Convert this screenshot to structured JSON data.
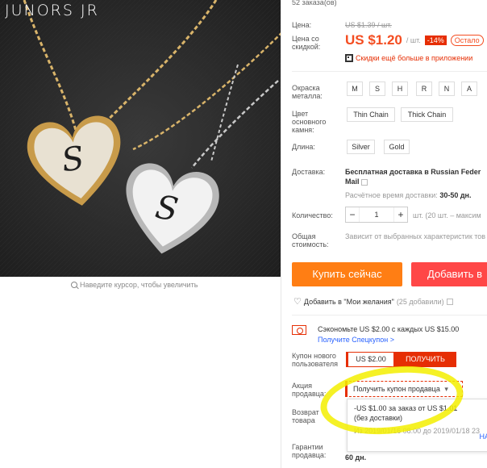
{
  "brand": "JUNORS JR",
  "zoom_hint": "Наведите курсор, чтобы увеличить",
  "orders": "52 заказа(ов)",
  "price": {
    "label": "Цена:",
    "old": "US $1.39 / шт.",
    "discount_label": "Цена со скидкой:",
    "current": "US $1.20",
    "unit": "/ шт.",
    "discount": "-14%",
    "remaining": "Остало",
    "app_promo": "Скидки ещё больше в приложении"
  },
  "options": {
    "metal_label": "Окраска металла:",
    "metal_values": [
      "M",
      "S",
      "H",
      "R",
      "N",
      "A"
    ],
    "stone_label": "Цвет основного камня:",
    "stone_values": [
      "Thin Chain",
      "Thick Chain"
    ],
    "length_label": "Длина:",
    "length_values": [
      "Silver",
      "Gold"
    ]
  },
  "shipping": {
    "label": "Доставка:",
    "line1_bold": "Бесплатная доставка",
    "line1_rest": " в Russian Feder",
    "line2": "Mail",
    "time_label": "Расчётное время доставки:",
    "time_value": "30-50 дн."
  },
  "quantity": {
    "label": "Количество:",
    "minus": "−",
    "value": "1",
    "plus": "+",
    "stock": "шт. (20 шт. – максим"
  },
  "total": {
    "label": "Общая стоимость:",
    "value": "Зависит от выбранных характеристик тов"
  },
  "buttons": {
    "buy": "Купить сейчас",
    "cart": "Добавить в"
  },
  "wishlist": {
    "text": "Добавить в \"Мои желания\"",
    "count": "(25 добавили)"
  },
  "coupon": {
    "save_text": "Сэкономьте US $2.00 с каждых US $15.00",
    "special_link": "Получите Спецкупон >",
    "new_user_label": "Купон нового пользователя",
    "amount": "US $2.00",
    "get_button": "ПОЛУЧИТЬ",
    "seller_label": "Акция продавца:",
    "seller_select": "Получить купон продавца",
    "offer_line1": "-US $1.00 за заказ от US $1.01",
    "offer_line2": "(без доставки)",
    "offer_dates": "Из 2019/01/16 08:00 до 2019/01/18 23",
    "offer_more": "НА"
  },
  "returns_label": "Возврат товара",
  "guarantee": {
    "label": "Гарантии продавца:",
    "value": "60 дн."
  },
  "colors": {
    "price": "#f44d21",
    "buy": "#ff7e14",
    "cart": "#ff4747",
    "accent": "#e62e04",
    "highlight": "#f3ef00"
  }
}
